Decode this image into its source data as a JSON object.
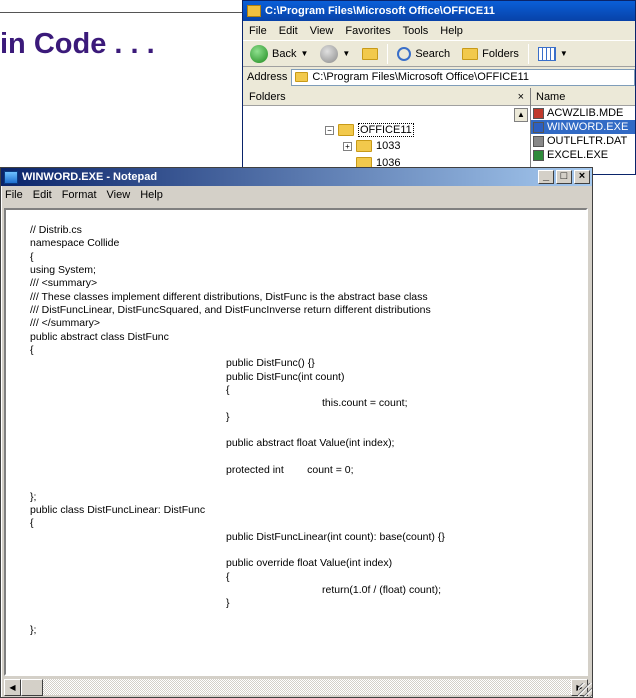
{
  "slide": {
    "title_fragment": "in Code . . ."
  },
  "explorer": {
    "title": "C:\\Program Files\\Microsoft Office\\OFFICE11",
    "menu": [
      "File",
      "Edit",
      "View",
      "Favorites",
      "Tools",
      "Help"
    ],
    "toolbar": {
      "back_label": "Back",
      "search_label": "Search",
      "folders_label": "Folders"
    },
    "address_label": "Address",
    "address_value": "C:\\Program Files\\Microsoft Office\\OFFICE11",
    "folders_pane_title": "Folders",
    "tree": [
      {
        "label": "OFFICE11",
        "expander": "−",
        "selected": true
      },
      {
        "label": "1033",
        "expander": "+",
        "selected": false
      },
      {
        "label": "1036",
        "expander": "",
        "selected": false
      }
    ],
    "files_column": "Name",
    "files": [
      {
        "name": "ACWZLIB.MDE",
        "icon": "mde-file-icon",
        "selected": false
      },
      {
        "name": "WINWORD.EXE",
        "icon": "word-exe-icon",
        "selected": true
      },
      {
        "name": "OUTLFLTR.DAT",
        "icon": "dat-file-icon",
        "selected": false
      },
      {
        "name": "EXCEL.EXE",
        "icon": "excel-exe-icon",
        "selected": false
      }
    ]
  },
  "notepad": {
    "title": "WINWORD.EXE - Notepad",
    "menu": [
      "File",
      "Edit",
      "Format",
      "View",
      "Help"
    ],
    "controls": [
      "_",
      "□",
      "×"
    ],
    "code_lines": [
      "// Distrib.cs",
      "namespace Collide",
      "{",
      "using System;",
      "/// <summary>",
      "/// These classes implement different distributions, DistFunc is the abstract base class",
      "/// DistFuncLinear, DistFuncSquared, and DistFuncInverse return different distributions",
      "/// </summary>",
      "public abstract class DistFunc",
      "{",
      "public DistFunc() {}",
      "public DistFunc(int count)",
      "{",
      "this.count = count;",
      "}",
      "",
      "public abstract float Value(int index);",
      "",
      "protected int        count = 0;",
      "",
      "};",
      "public class DistFuncLinear: DistFunc",
      "{",
      "public DistFuncLinear(int count): base(count) {}",
      "",
      "public override float Value(int index)",
      "{",
      "return(1.0f / (float) count);",
      "}",
      "",
      "};"
    ]
  }
}
